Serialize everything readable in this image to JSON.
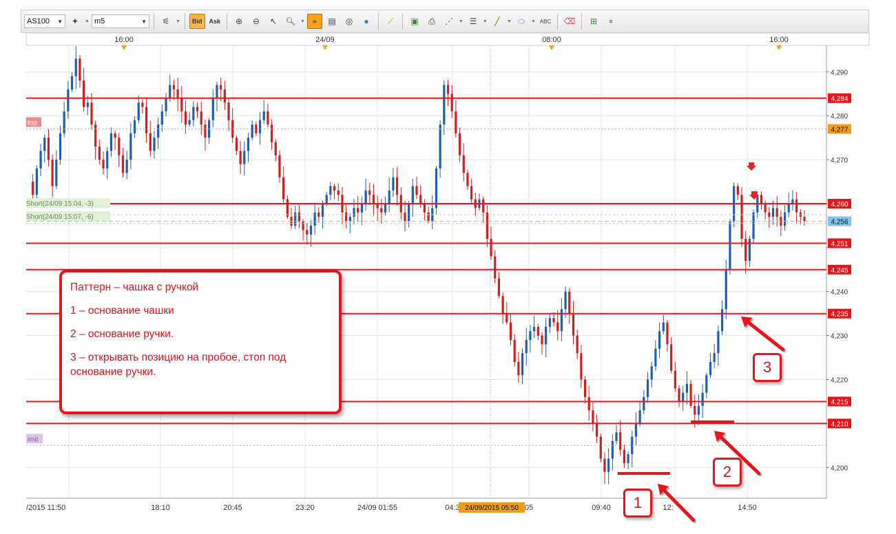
{
  "toolbar": {
    "symbol": "AS100",
    "timeframe": "m5",
    "bid_label": "Bid",
    "ask_label": "Ask",
    "buttons": [
      "chart-type-icon",
      "zoom-in-icon",
      "zoom-out-icon",
      "pointer-icon",
      "magnify-icon",
      "crosshair-icon",
      "template-icon",
      "eye-icon",
      "globe-icon",
      "ruler-icon",
      "image-icon",
      "print-icon",
      "fibonacci-icon",
      "lines-icon",
      "trendline-icon",
      "ellipse-icon",
      "text-abc-icon",
      "eraser-icon",
      "hierarchy-icon",
      "settings-icon"
    ]
  },
  "colors": {
    "level_line": "#e8141b",
    "bull_candle": "#1f5ea8",
    "bear_candle": "#d01d1d",
    "grid": "#e3e3e3",
    "price_tag": "#e8141b",
    "current_tag": "#7fc4ef",
    "stop_tag": "#f39a1a"
  },
  "chart_data": {
    "type": "candlestick",
    "title": "",
    "ylim": [
      4193,
      4296
    ],
    "yticks": [
      4200,
      4210,
      4220,
      4230,
      4240,
      4250,
      4260,
      4270,
      4280,
      4290
    ],
    "ytick_labels": [
      "4,200",
      "",
      "4,220",
      "4,230",
      "4,240",
      "",
      "",
      "4,270",
      "4,280",
      "4,290"
    ],
    "top_time_labels": [
      "16:00",
      "24/09",
      "08:00",
      "16:00"
    ],
    "bottom_time_labels": [
      "/2015 11:50",
      "18:10",
      "20:45",
      "23:20",
      "24/09 01:55",
      "04:3",
      "",
      "05",
      "09:40",
      "12:",
      "14:50"
    ],
    "cursor_time_label": "24/09/2015 05:50",
    "levels": [
      4284,
      4260,
      4251,
      4245,
      4235,
      4215,
      4210
    ],
    "level_labels": [
      "4,284",
      "4,260",
      "4,251",
      "4,245",
      "4,235",
      "4,215",
      "4,210"
    ],
    "current_price": 4256,
    "current_price_label": "4,256",
    "stop_price": 4277,
    "stop_price_label": "4,277",
    "limit_price": 4205,
    "orders": [
      "Short(24/09 15:04, -3)",
      "Short(24/09 15:07, -6)"
    ],
    "stop_tag": "top",
    "limit_tag": "imit",
    "candle_path": [
      4265,
      4262,
      4268,
      4272,
      4275,
      4270,
      4264,
      4270,
      4276,
      4281,
      4286,
      4289,
      4293,
      4288,
      4282,
      4283,
      4278,
      4273,
      4270,
      4268,
      4272,
      4276,
      4275,
      4271,
      4267,
      4270,
      4276,
      4279,
      4283,
      4282,
      4276,
      4272,
      4275,
      4278,
      4281,
      4284,
      4287,
      4286,
      4284,
      4281,
      4278,
      4279,
      4282,
      4281,
      4278,
      4275,
      4279,
      4284,
      4287,
      4286,
      4283,
      4279,
      4275,
      4272,
      4269,
      4272,
      4275,
      4278,
      4276,
      4279,
      4281,
      4278,
      4274,
      4271,
      4266,
      4261,
      4257,
      4255,
      4258,
      4256,
      4254,
      4253,
      4255,
      4258,
      4257,
      4260,
      4262,
      4264,
      4263,
      4262,
      4258,
      4256,
      4257,
      4259,
      4258,
      4260,
      4263,
      4262,
      4260,
      4259,
      4258,
      4260,
      4263,
      4266,
      4262,
      4258,
      4256,
      4260,
      4264,
      4262,
      4260,
      4258,
      4256,
      4259,
      4268,
      4278,
      4287,
      4285,
      4281,
      4276,
      4271,
      4267,
      4264,
      4261,
      4259,
      4261,
      4258,
      4252,
      4248,
      4243,
      4239,
      4235,
      4233,
      4229,
      4224,
      4221,
      4226,
      4229,
      4231,
      4232,
      4230,
      4228,
      4232,
      4234,
      4233,
      4231,
      4236,
      4240,
      4235,
      4230,
      4226,
      4220,
      4216,
      4213,
      4210,
      4207,
      4202,
      4199,
      4202,
      4206,
      4208,
      4204,
      4201,
      4203,
      4207,
      4210,
      4213,
      4216,
      4220,
      4223,
      4227,
      4231,
      4233,
      4228,
      4222,
      4218,
      4215,
      4217,
      4219,
      4214,
      4212,
      4214,
      4217,
      4221,
      4224,
      4226,
      4231,
      4236,
      4245,
      4256,
      4264,
      4262,
      4252,
      4247,
      4252,
      4258,
      4262,
      4260,
      4258,
      4257,
      4259,
      4257,
      4255,
      4258,
      4260,
      4261,
      4258,
      4257,
      4256
    ]
  },
  "annotation": {
    "title": "Паттерн – чашка с ручкой",
    "line1": "1 – основание чашки",
    "line2": "2 – основание ручки.",
    "line3": "3 – открывать позицию на пробое, стоп под основание ручки."
  },
  "markers": {
    "m1": "1",
    "m2": "2",
    "m3": "3"
  }
}
